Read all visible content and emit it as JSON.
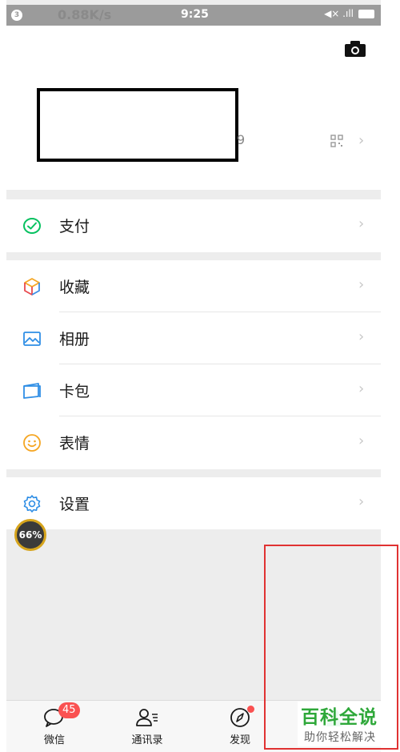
{
  "status_bar": {
    "sim": "3",
    "net_speed": "0.88K/s",
    "time": "9:25",
    "signal": "◀× .ıll"
  },
  "profile": {
    "wxid_tail": "9"
  },
  "menu": {
    "pay": "支付",
    "favorites": "收藏",
    "album": "相册",
    "cards": "卡包",
    "stickers": "表情",
    "settings": "设置"
  },
  "chevron": "›",
  "speed_widget": {
    "value": "66%"
  },
  "tabs": {
    "chats": {
      "label": "微信",
      "badge": "45"
    },
    "contacts": {
      "label": "通讯录"
    },
    "discover": {
      "label": "发现"
    }
  },
  "watermark": {
    "title": "百科全说",
    "subtitle": "助你轻松解决"
  },
  "colors": {
    "accent_green": "#07c160",
    "badge_red": "#fa5151",
    "annotation_red": "#e03232",
    "watermark_green": "#2fa83a"
  }
}
